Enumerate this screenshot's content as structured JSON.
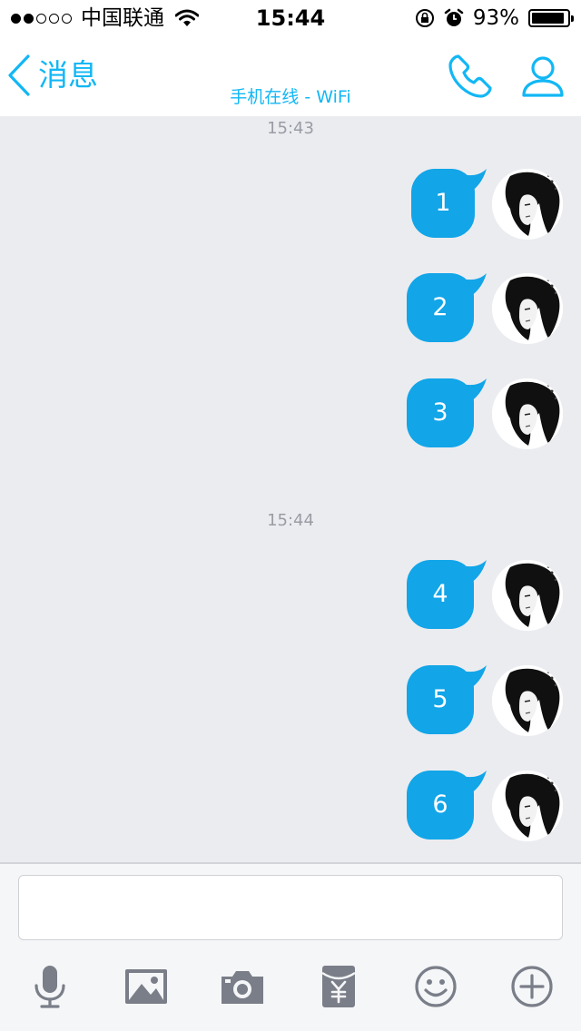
{
  "status_bar": {
    "signal_dots": [
      true,
      true,
      false,
      false,
      false
    ],
    "carrier": "中国联通",
    "time": "15:44",
    "battery": "93%",
    "battery_level": 0.93
  },
  "nav": {
    "back_label": "消息",
    "subtitle": "手机在线 - WiFi",
    "icons": [
      "phone-icon",
      "profile-icon"
    ]
  },
  "chat": {
    "groups": [
      {
        "timestamp": "15:43",
        "messages": [
          "1",
          "2",
          "3"
        ]
      },
      {
        "timestamp": "15:44",
        "messages": [
          "4",
          "5",
          "6"
        ]
      }
    ]
  },
  "input": {
    "value": "",
    "placeholder": ""
  },
  "toolbar": [
    "microphone-icon",
    "image-icon",
    "camera-icon",
    "red-packet-icon",
    "emoji-icon",
    "plus-icon"
  ],
  "colors": {
    "accent": "#12b7f5",
    "bubble": "#12a5e8",
    "background": "#ebecf0",
    "toolbar_icon": "#7a7e88"
  }
}
